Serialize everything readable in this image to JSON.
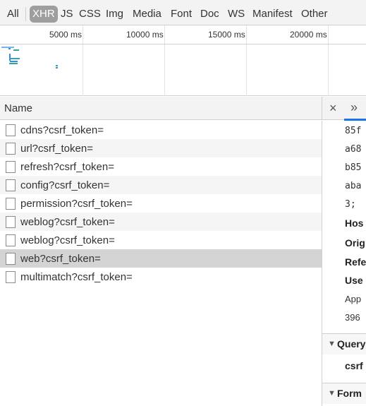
{
  "filters": {
    "all": "All",
    "types": [
      "XHR",
      "JS",
      "CSS",
      "Img",
      "Media",
      "Font",
      "Doc",
      "WS",
      "Manifest",
      "Other"
    ],
    "active": "XHR"
  },
  "timeline": {
    "ticks": [
      "5000 ms",
      "10000 ms",
      "15000 ms",
      "20000 ms"
    ]
  },
  "requests": {
    "header": "Name",
    "items": [
      "cdns?csrf_token=",
      "url?csrf_token=",
      "refresh?csrf_token=",
      "config?csrf_token=",
      "permission?csrf_token=",
      "weblog?csrf_token=",
      "weblog?csrf_token=",
      "web?csrf_token=",
      "multimatch?csrf_token="
    ],
    "selected_index": 7
  },
  "details": {
    "close": "×",
    "more": "»",
    "lines": [
      "85f",
      "a68",
      "b85",
      "aba",
      "3; ",
      "Hos",
      "Orig",
      "Refe",
      "Use",
      "App",
      "396"
    ],
    "sections": [
      "Query",
      "Form"
    ],
    "query_param": "csrf",
    "tab_accent": "#1a73e8"
  }
}
